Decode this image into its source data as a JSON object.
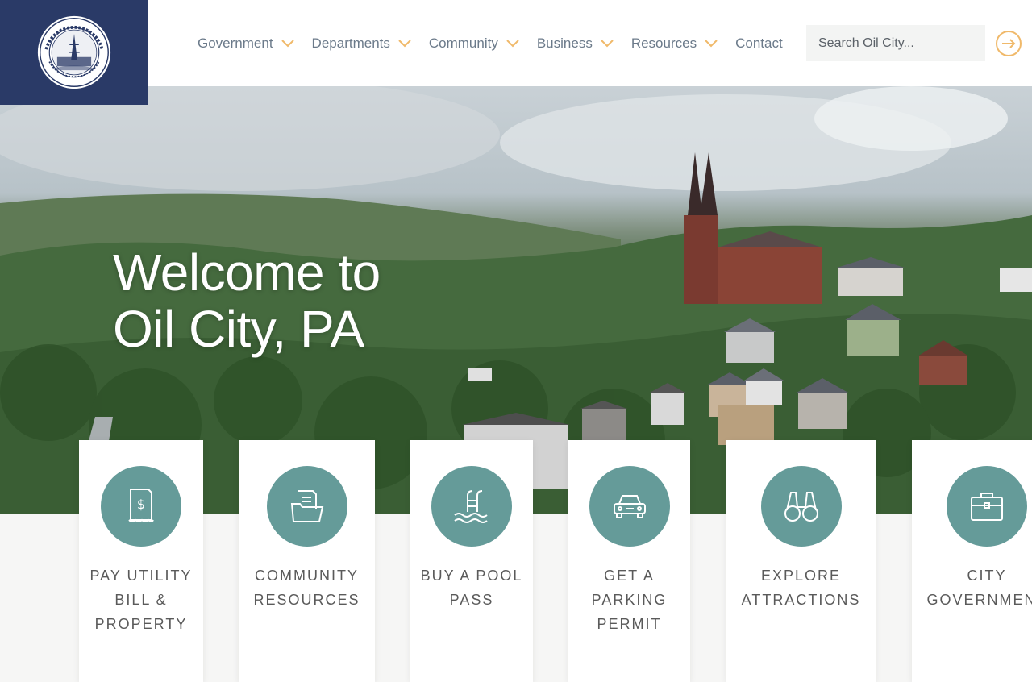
{
  "logo": {
    "alt": "City of Oil City, PA seal"
  },
  "nav": {
    "items": [
      {
        "label": "Government",
        "has_dropdown": true
      },
      {
        "label": "Departments",
        "has_dropdown": true
      },
      {
        "label": "Community",
        "has_dropdown": true
      },
      {
        "label": "Business",
        "has_dropdown": true
      },
      {
        "label": "Resources",
        "has_dropdown": true
      },
      {
        "label": "Contact",
        "has_dropdown": false
      }
    ]
  },
  "search": {
    "placeholder": "Search Oil City...",
    "value": ""
  },
  "hero": {
    "title_line1": "Welcome to",
    "title_line2": "Oil City, PA"
  },
  "cards": [
    {
      "label": "Pay Utility Bill & Property",
      "icon": "bill-icon"
    },
    {
      "label": "Community Resources",
      "icon": "folder-icon"
    },
    {
      "label": "Buy a Pool Pass",
      "icon": "pool-icon"
    },
    {
      "label": "Get a Parking Permit",
      "icon": "car-icon"
    },
    {
      "label": "Explore Attractions",
      "icon": "binoculars-icon"
    },
    {
      "label": "City Government",
      "icon": "briefcase-icon"
    }
  ],
  "colors": {
    "navy": "#2a3a67",
    "teal": "#659b99",
    "accent_orange": "#f0b96a",
    "nav_text": "#6b7a8a"
  }
}
